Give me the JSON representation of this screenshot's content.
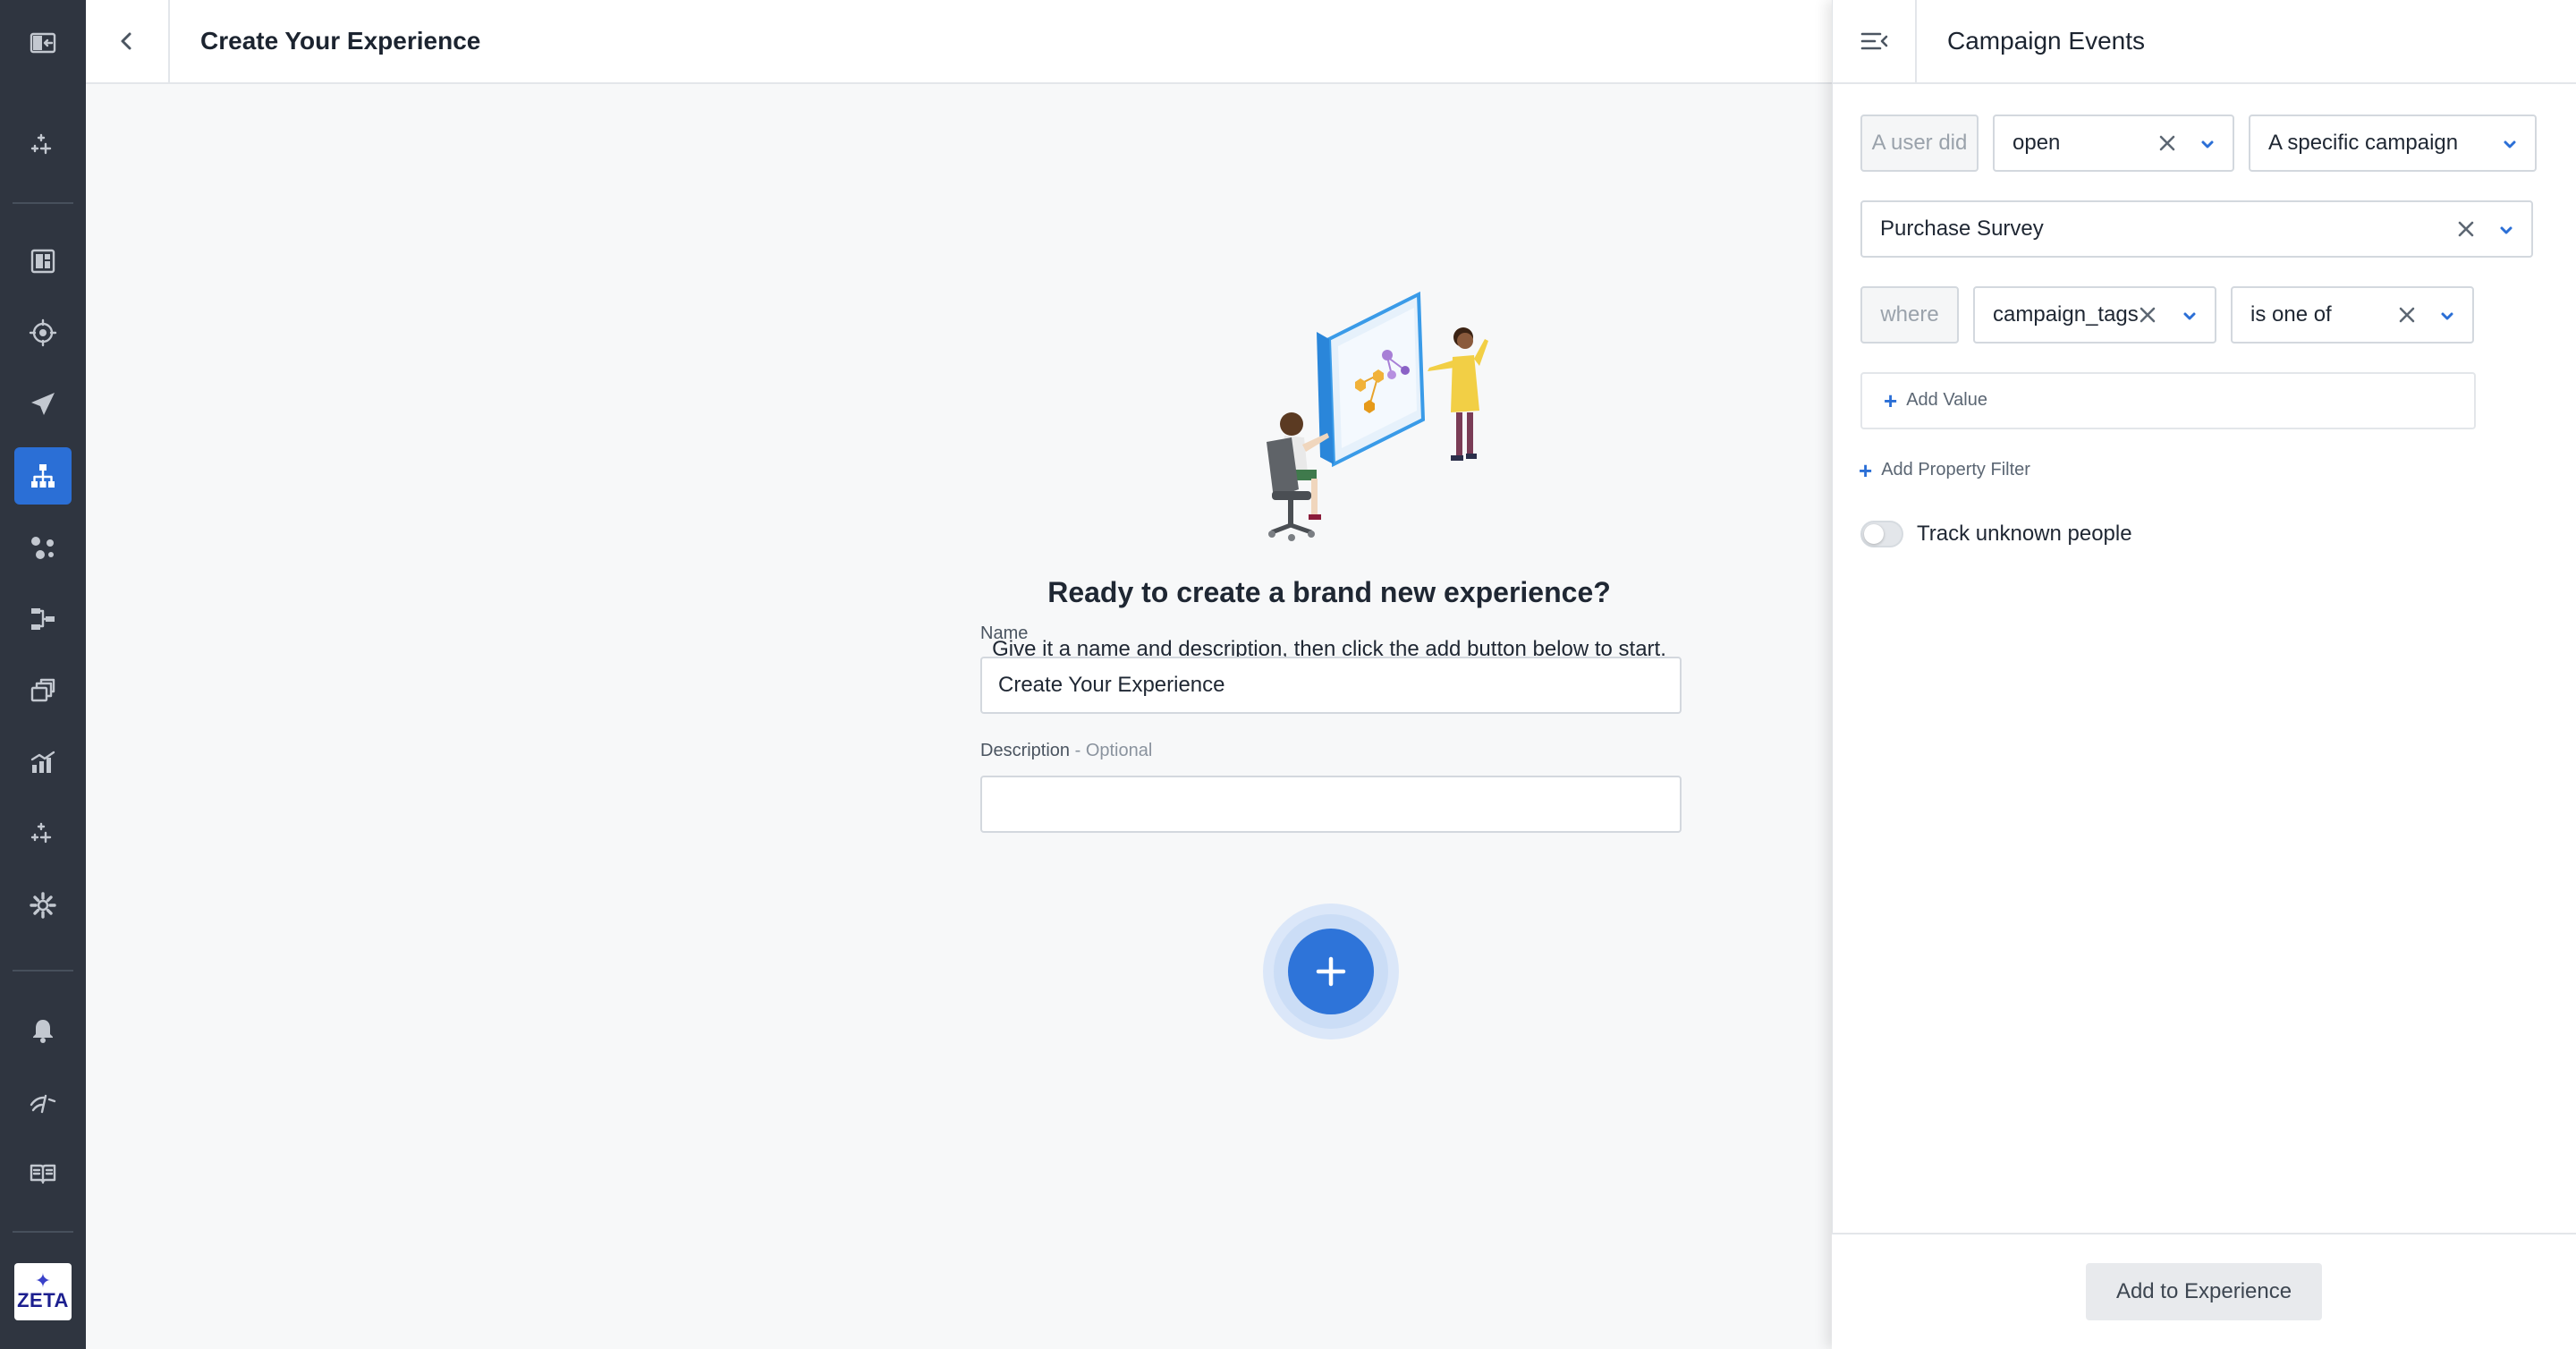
{
  "header": {
    "title": "Create Your Experience"
  },
  "rail": {
    "items": [
      {
        "icon": "collapse-rail-icon"
      },
      {
        "icon": "sparkle-icon"
      },
      {
        "icon": "dashboard-icon"
      },
      {
        "icon": "target-icon"
      },
      {
        "icon": "send-icon"
      },
      {
        "icon": "org-chart-icon",
        "active": true
      },
      {
        "icon": "nodes-icon"
      },
      {
        "icon": "flow-icon"
      },
      {
        "icon": "layers-icon"
      },
      {
        "icon": "analytics-icon"
      },
      {
        "icon": "magic-icon"
      },
      {
        "icon": "settings-icon"
      },
      {
        "icon": "bell-icon"
      },
      {
        "icon": "signal-icon"
      },
      {
        "icon": "book-icon"
      }
    ],
    "logo_text": "ZETA"
  },
  "main": {
    "heading": "Ready to create a brand new experience?",
    "subheading": "Give it a name and description, then click the add button below to start.",
    "name_label": "Name",
    "name_value": "Create Your Experience",
    "description_label": "Description",
    "description_optional": " - Optional",
    "description_value": ""
  },
  "panel": {
    "title": "Campaign Events",
    "row1": {
      "static_label": "A user did",
      "action_value": "open",
      "campaign_scope": "A specific campaign"
    },
    "campaign_value": "Purchase Survey",
    "filter": {
      "static_label": "where",
      "property": "campaign_tags",
      "operator": "is one of"
    },
    "add_value_label": "Add Value",
    "add_property_filter_label": "Add Property Filter",
    "track_unknown_label": "Track unknown people",
    "track_unknown_enabled": false,
    "submit_label": "Add to Experience"
  },
  "colors": {
    "rail": "#2f3540",
    "accent": "#2b6fd6",
    "background": "#f7f8f9"
  }
}
